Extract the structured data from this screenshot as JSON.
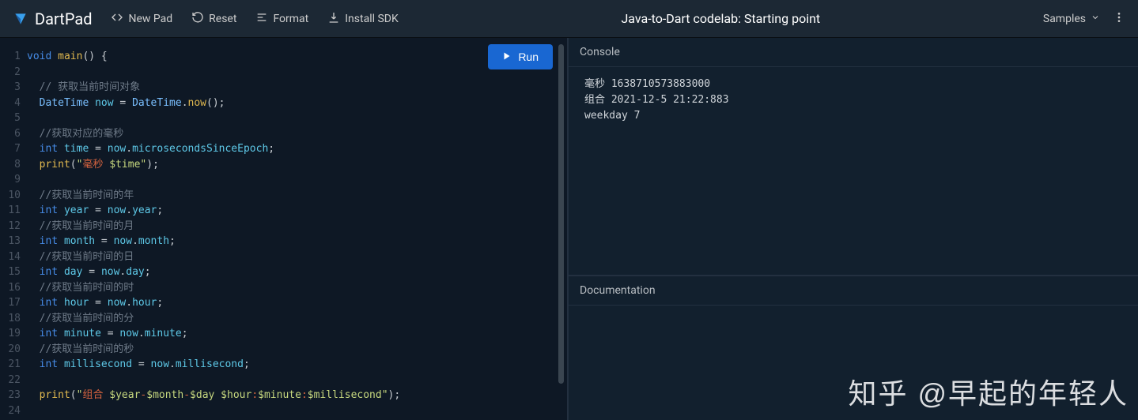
{
  "header": {
    "brand": "DartPad",
    "new_pad": "New Pad",
    "reset": "Reset",
    "format": "Format",
    "install_sdk": "Install SDK",
    "title": "Java-to-Dart codelab: Starting point",
    "samples": "Samples"
  },
  "run_button": "Run",
  "panels": {
    "console": "Console",
    "documentation": "Documentation"
  },
  "console_output": "毫秒 1638710573883000\n组合 2021-12-5 21:22:883\nweekday 7",
  "watermark": "知乎 @早起的年轻人",
  "code_lines": [
    {
      "n": 1,
      "t": [
        [
          "kw",
          "void"
        ],
        [
          "",
          " "
        ],
        [
          "fn",
          "main"
        ],
        [
          "",
          "() {"
        ]
      ]
    },
    {
      "n": 2,
      "t": []
    },
    {
      "n": 3,
      "t": [
        [
          "",
          "  "
        ],
        [
          "com",
          "// 获取当前时间对象"
        ]
      ]
    },
    {
      "n": 4,
      "t": [
        [
          "",
          "  "
        ],
        [
          "type",
          "DateTime"
        ],
        [
          "",
          " "
        ],
        [
          "prop",
          "now"
        ],
        [
          "",
          " = "
        ],
        [
          "type",
          "DateTime"
        ],
        [
          "",
          "."
        ],
        [
          "fn",
          "now"
        ],
        [
          "",
          "();"
        ]
      ]
    },
    {
      "n": 5,
      "t": []
    },
    {
      "n": 6,
      "t": [
        [
          "",
          "  "
        ],
        [
          "com",
          "//获取对应的毫秒"
        ]
      ]
    },
    {
      "n": 7,
      "t": [
        [
          "",
          "  "
        ],
        [
          "kw",
          "int"
        ],
        [
          "",
          " "
        ],
        [
          "prop",
          "time"
        ],
        [
          "",
          " = "
        ],
        [
          "prop",
          "now"
        ],
        [
          "",
          "."
        ],
        [
          "prop",
          "microsecondsSinceEpoch"
        ],
        [
          "",
          ";"
        ]
      ]
    },
    {
      "n": 8,
      "t": [
        [
          "",
          "  "
        ],
        [
          "fn",
          "print"
        ],
        [
          "",
          "("
        ],
        [
          "str",
          "\""
        ],
        [
          "sv",
          "毫秒 "
        ],
        [
          "str",
          "$time\""
        ],
        [
          "",
          ");"
        ]
      ]
    },
    {
      "n": 9,
      "t": []
    },
    {
      "n": 10,
      "t": [
        [
          "",
          "  "
        ],
        [
          "com",
          "//获取当前时间的年"
        ]
      ]
    },
    {
      "n": 11,
      "t": [
        [
          "",
          "  "
        ],
        [
          "kw",
          "int"
        ],
        [
          "",
          " "
        ],
        [
          "prop",
          "year"
        ],
        [
          "",
          " = "
        ],
        [
          "prop",
          "now"
        ],
        [
          "",
          "."
        ],
        [
          "prop",
          "year"
        ],
        [
          "",
          ";"
        ]
      ]
    },
    {
      "n": 12,
      "t": [
        [
          "",
          "  "
        ],
        [
          "com",
          "//获取当前时间的月"
        ]
      ]
    },
    {
      "n": 13,
      "t": [
        [
          "",
          "  "
        ],
        [
          "kw",
          "int"
        ],
        [
          "",
          " "
        ],
        [
          "prop",
          "month"
        ],
        [
          "",
          " = "
        ],
        [
          "prop",
          "now"
        ],
        [
          "",
          "."
        ],
        [
          "prop",
          "month"
        ],
        [
          "",
          ";"
        ]
      ]
    },
    {
      "n": 14,
      "t": [
        [
          "",
          "  "
        ],
        [
          "com",
          "//获取当前时间的日"
        ]
      ]
    },
    {
      "n": 15,
      "t": [
        [
          "",
          "  "
        ],
        [
          "kw",
          "int"
        ],
        [
          "",
          " "
        ],
        [
          "prop",
          "day"
        ],
        [
          "",
          " = "
        ],
        [
          "prop",
          "now"
        ],
        [
          "",
          "."
        ],
        [
          "prop",
          "day"
        ],
        [
          "",
          ";"
        ]
      ]
    },
    {
      "n": 16,
      "t": [
        [
          "",
          "  "
        ],
        [
          "com",
          "//获取当前时间的时"
        ]
      ]
    },
    {
      "n": 17,
      "t": [
        [
          "",
          "  "
        ],
        [
          "kw",
          "int"
        ],
        [
          "",
          " "
        ],
        [
          "prop",
          "hour"
        ],
        [
          "",
          " = "
        ],
        [
          "prop",
          "now"
        ],
        [
          "",
          "."
        ],
        [
          "prop",
          "hour"
        ],
        [
          "",
          ";"
        ]
      ]
    },
    {
      "n": 18,
      "t": [
        [
          "",
          "  "
        ],
        [
          "com",
          "//获取当前时间的分"
        ]
      ]
    },
    {
      "n": 19,
      "t": [
        [
          "",
          "  "
        ],
        [
          "kw",
          "int"
        ],
        [
          "",
          " "
        ],
        [
          "prop",
          "minute"
        ],
        [
          "",
          " = "
        ],
        [
          "prop",
          "now"
        ],
        [
          "",
          "."
        ],
        [
          "prop",
          "minute"
        ],
        [
          "",
          ";"
        ]
      ]
    },
    {
      "n": 20,
      "t": [
        [
          "",
          "  "
        ],
        [
          "com",
          "//获取当前时间的秒"
        ]
      ]
    },
    {
      "n": 21,
      "t": [
        [
          "",
          "  "
        ],
        [
          "kw",
          "int"
        ],
        [
          "",
          " "
        ],
        [
          "prop",
          "millisecond"
        ],
        [
          "",
          " = "
        ],
        [
          "prop",
          "now"
        ],
        [
          "",
          "."
        ],
        [
          "prop",
          "millisecond"
        ],
        [
          "",
          ";"
        ]
      ]
    },
    {
      "n": 22,
      "t": []
    },
    {
      "n": 23,
      "t": [
        [
          "",
          "  "
        ],
        [
          "fn",
          "print"
        ],
        [
          "",
          "("
        ],
        [
          "str",
          "\""
        ],
        [
          "sv",
          "组合 "
        ],
        [
          "str",
          "$year"
        ],
        [
          "sv",
          "-"
        ],
        [
          "str",
          "$month"
        ],
        [
          "sv",
          "-"
        ],
        [
          "str",
          "$day $hour"
        ],
        [
          "sv",
          ":"
        ],
        [
          "str",
          "$minute"
        ],
        [
          "sv",
          ":"
        ],
        [
          "str",
          "$millisecond\""
        ],
        [
          "",
          ");"
        ]
      ]
    },
    {
      "n": 24,
      "t": []
    }
  ]
}
